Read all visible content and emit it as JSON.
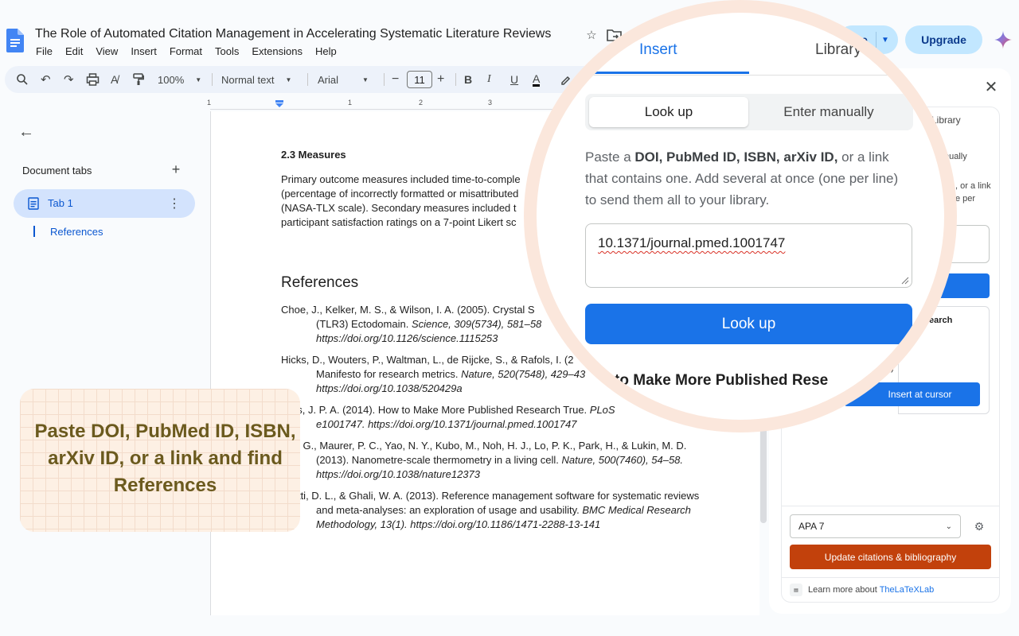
{
  "title_bar": {
    "doc_title": "The Role of Automated Citation Management in Accelerating Systematic Literature Reviews",
    "share_label": "e",
    "upgrade_label": "Upgrade"
  },
  "menu": [
    "File",
    "Edit",
    "View",
    "Insert",
    "Format",
    "Tools",
    "Extensions",
    "Help"
  ],
  "toolbar": {
    "zoom": "100%",
    "style": "Normal text",
    "font": "Arial",
    "font_size": "11"
  },
  "ruler": [
    "1",
    "1",
    "2",
    "3"
  ],
  "left_panel": {
    "heading": "Document tabs",
    "tab_label": "Tab 1",
    "outline_item": "References"
  },
  "document": {
    "section_heading": "2.3 Measures",
    "measures_lines": [
      "Primary outcome measures included time-to-comple",
      "(percentage of incorrectly formatted or misattributed",
      "(NASA-TLX scale). Secondary measures included t",
      "participant satisfaction ratings on a 7-point Likert sc"
    ],
    "refs_heading": "References",
    "references": [
      {
        "line1": "Choe, J., Kelker, M. S., & Wilson, I. A. (2005). Crystal S",
        "line2_plain": "(TLR3) Ectodomain. ",
        "line2_italic": "Science, 309(5734), 581–58",
        "line3": "https://doi.org/10.1126/science.1115253"
      },
      {
        "line1": "Hicks, D., Wouters, P., Waltman, L., de Rijcke, S., & Rafols, I. (2",
        "line2_plain": "Manifesto for research metrics. ",
        "line2_italic": "Nature, 520(7548), 429–43",
        "line3": "https://doi.org/10.1038/520429a"
      },
      {
        "line1_plain": "nidis, J. P. A. (2014). How to Make More Published Research True. ",
        "line1_italic": "PLoS",
        "line2": "e1001747. https://doi.org/10.1371/journal.pmed.1001747"
      },
      {
        "line1": "sko, G., Maurer, P. C., Yao, N. Y., Kubo, M., Noh, H. J., Lo, P. K., Park, H., & Lukin, M. D.",
        "line2_plain": "(2013). Nanometre-scale thermometry in a living cell. ",
        "line2_italic": "Nature, 500(7460), 54–58.",
        "line3": "https://doi.org/10.1038/nature12373"
      },
      {
        "line1": "nzetti, D. L., & Ghali, W. A. (2013). Reference management software for systematic reviews",
        "line2_plain": "and meta-analyses: an exploration of usage and usability. ",
        "line2_italic": "BMC Medical Research",
        "line3": "Methodology, 13(1). https://doi.org/10.1186/1471-2288-13-141"
      }
    ]
  },
  "sidebar": {
    "library_tab_partial": "Library",
    "manually_partial": "nually",
    "desc_partial": [
      ", or a link",
      "e per"
    ],
    "result_title_partial": "d Research",
    "result_meta_partial": "4)",
    "insert_cursor": "Insert at cursor",
    "style_value": "APA 7",
    "update_label": "Update citations & bibliography",
    "learn_more_prefix": "Learn more about ",
    "learn_more_link": "TheLaTeXLab"
  },
  "magnifier": {
    "tab_insert": "Insert",
    "tab_library": "Library",
    "seg_lookup": "Look up",
    "seg_manual": "Enter manually",
    "desc_prefix": "Paste a ",
    "desc_bold": "DOI, PubMed ID, ISBN, arXiv ID,",
    "desc_rest": " or a link that contains one. Add several at once (one per line) to send them all to your library.",
    "input_value": "10.1371/journal.pmed.1001747",
    "lookup_button": "Look up",
    "result_title": "w to Make More Published Rese"
  },
  "callout": {
    "text": "Paste DOI, PubMed ID, ISBN, arXiv ID, or a link and find References"
  },
  "colors": {
    "accent": "#1a73e8",
    "update_button": "#c2410c",
    "callout_bg": "#fdf0e4",
    "callout_text": "#6b5a1e",
    "magnifier_ring": "#fbe7dc"
  }
}
